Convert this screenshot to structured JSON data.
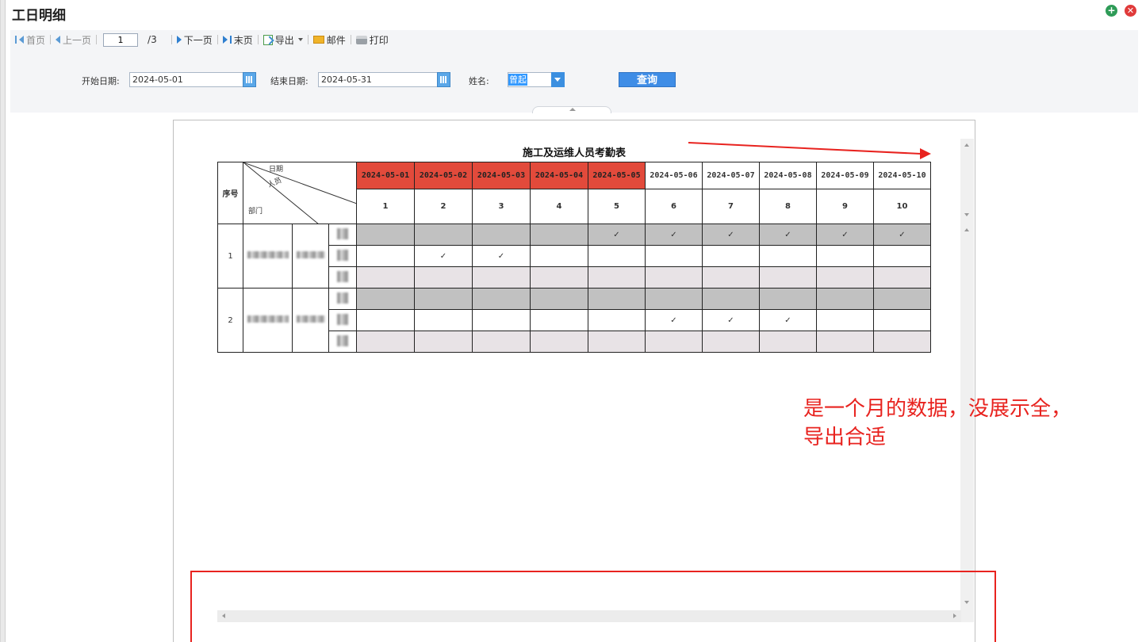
{
  "window": {
    "title": "工日明细",
    "add_icon": "plus-circle-icon",
    "close_icon": "close-circle-icon"
  },
  "toolbar": {
    "first": "首页",
    "prev": "上一页",
    "page_value": "1",
    "page_total": "/3",
    "next": "下一页",
    "last": "末页",
    "export": "导出",
    "mail": "邮件",
    "print": "打印"
  },
  "filter": {
    "start_label": "开始日期:",
    "start_value": "2024-05-01",
    "end_label": "结束日期:",
    "end_value": "2024-05-31",
    "name_label": "姓名:",
    "name_value": "曾起",
    "query": "查询"
  },
  "report": {
    "title": "施工及运维人员考勤表",
    "seq_header": "序号",
    "diag_date": "日期",
    "diag_person": "人员",
    "diag_dept": "部门",
    "dates": [
      "2024-05-01",
      "2024-05-02",
      "2024-05-03",
      "2024-05-04",
      "2024-05-05",
      "2024-05-06",
      "2024-05-07",
      "2024-05-08",
      "2024-05-09",
      "2024-05-10"
    ],
    "days": [
      "1",
      "2",
      "3",
      "4",
      "5",
      "6",
      "7",
      "8",
      "9",
      "10"
    ],
    "rows": [
      {
        "seq": "1",
        "lines": [
          {
            "shade": "gray",
            "marks": [
              "",
              "",
              "",
              "",
              "✓",
              "✓",
              "✓",
              "✓",
              "✓",
              "✓"
            ]
          },
          {
            "shade": "white",
            "marks": [
              "",
              "✓",
              "✓",
              "",
              "",
              "",
              "",
              "",
              "",
              ""
            ]
          },
          {
            "shade": "light",
            "marks": [
              "",
              "",
              "",
              "",
              "",
              "",
              "",
              "",
              "",
              ""
            ]
          }
        ]
      },
      {
        "seq": "2",
        "lines": [
          {
            "shade": "gray",
            "marks": [
              "",
              "",
              "",
              "",
              "",
              "",
              "",
              "",
              "",
              ""
            ]
          },
          {
            "shade": "white",
            "marks": [
              "",
              "",
              "",
              "",
              "",
              "✓",
              "✓",
              "✓",
              "",
              ""
            ]
          },
          {
            "shade": "light",
            "marks": [
              "",
              "",
              "",
              "",
              "",
              "",
              "",
              "",
              "",
              ""
            ]
          }
        ]
      }
    ]
  },
  "annotation": {
    "line1": "是一个月的数据，没展示全，",
    "line2": "导出合适"
  },
  "colors": {
    "weekend_header": "#e24a3b",
    "annotation": "#e8231f",
    "query_button": "#3f8de6"
  }
}
